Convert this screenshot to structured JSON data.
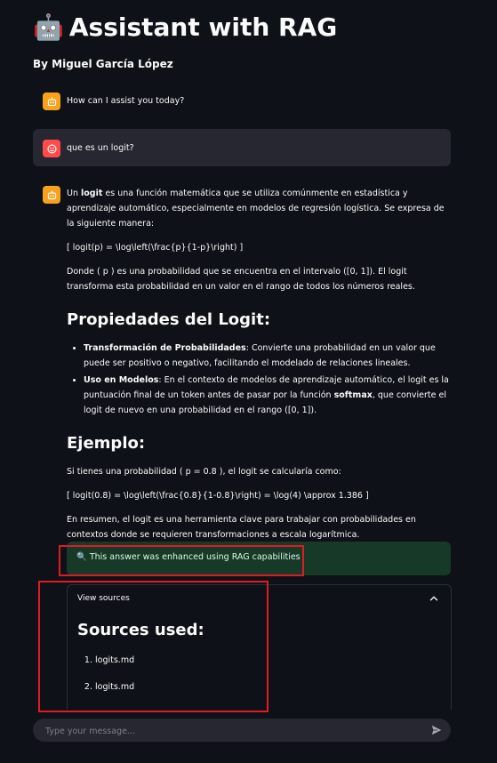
{
  "header": {
    "robot_emoji": "🤖",
    "title": "Assistant with RAG",
    "subtitle": "By Miguel García López"
  },
  "messages": {
    "greeting": "How can I assist you today?",
    "user_question": "que es un logit?"
  },
  "answer": {
    "p1_prefix": "Un ",
    "p1_bold": "logit",
    "p1_rest": " es una función matemática que se utiliza comúnmente en estadística y aprendizaje automático, especialmente en modelos de regresión logística. Se expresa de la siguiente manera:",
    "formula1": "[ logit(p) = \\log\\left(\\frac{p}{1-p}\\right) ]",
    "p2": "Donde ( p ) es una probabilidad que se encuentra en el intervalo ([0, 1]). El logit transforma esta probabilidad en un valor en el rango de todos los números reales.",
    "h_props": "Propiedades del Logit:",
    "li1_bold": "Transformación de Probabilidades",
    "li1_rest": ": Convierte una probabilidad en un valor que puede ser positivo o negativo, facilitando el modelado de relaciones lineales.",
    "li2_bold": "Uso en Modelos",
    "li2_mid": ": En el contexto de modelos de aprendizaje automático, el logit es la puntuación final de un token antes de pasar por la función ",
    "li2_bold2": "softmax",
    "li2_rest": ", que convierte el logit de nuevo en una probabilidad en el rango ([0, 1]).",
    "h_example": "Ejemplo:",
    "p3": "Si tienes una probabilidad ( p = 0.8 ), el logit se calcularía como:",
    "formula2": "[ logit(0.8) = \\log\\left(\\frac{0.8}{1-0.8}\\right) = \\log(4) \\approx 1.386 ]",
    "p4": "En resumen, el logit es una herramienta clave para trabajar con probabilidades en contextos donde se requieren transformaciones a escala logarítmica."
  },
  "rag_notice": "🔍 This answer was enhanced using RAG capabilities",
  "sources": {
    "expander_label": "View sources",
    "title": "Sources used:",
    "items": [
      "logits.md",
      "logits.md"
    ]
  },
  "chat_input": {
    "placeholder": "Type your message..."
  },
  "colors": {
    "background": "#0e1117",
    "bot_avatar": "#f7a21e",
    "user_avatar": "#ff4b4b",
    "rag_box": "#173928",
    "highlight": "#e01b24"
  }
}
